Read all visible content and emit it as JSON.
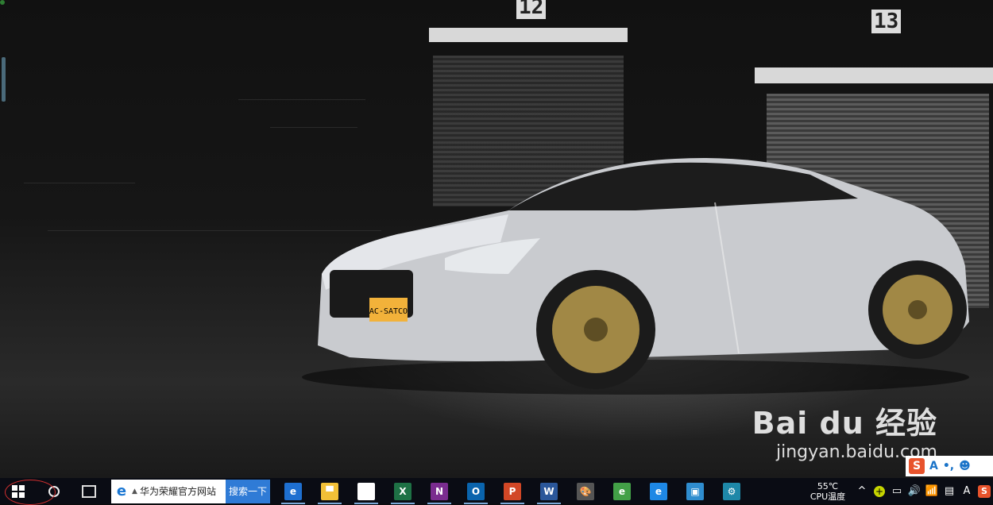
{
  "desktop": {
    "wallpaper": "silver sports car in dark garage",
    "bay_numbers": [
      "12",
      "13"
    ],
    "license_plate": "AC-SATCO",
    "watermark": {
      "logo": "Bai du 经验",
      "site": "jingyan.baidu.com"
    },
    "ime_bar": {
      "a_label": "A",
      "dot_label": "•,",
      "face_label": "☻",
      "s_label": "S"
    }
  },
  "taskbar": {
    "search": {
      "value": "华为荣耀官方网站",
      "button_label": "搜索一下",
      "ie_glyph": "e",
      "caret": "▲"
    },
    "pinned": [
      {
        "name": "edge",
        "glyph": "e",
        "color": "#1e6fd0"
      },
      {
        "name": "file-explorer",
        "glyph": "▀",
        "color": "#f2c037"
      },
      {
        "name": "store",
        "glyph": "⊞",
        "color": "#ffffff"
      },
      {
        "name": "excel",
        "glyph": "X",
        "color": "#1e7145"
      },
      {
        "name": "onenote",
        "glyph": "N",
        "color": "#7a2c8f"
      },
      {
        "name": "outlook",
        "glyph": "O",
        "color": "#0a64ad"
      },
      {
        "name": "powerpoint",
        "glyph": "P",
        "color": "#d24726"
      },
      {
        "name": "word",
        "glyph": "W",
        "color": "#2b579a"
      },
      {
        "name": "paint",
        "glyph": "🎨",
        "color": "#555555"
      },
      {
        "name": "360-browser",
        "glyph": "e",
        "color": "#43a047"
      },
      {
        "name": "internet-explorer",
        "glyph": "e",
        "color": "#1e88e5"
      },
      {
        "name": "photos",
        "glyph": "▣",
        "color": "#2f8dcf"
      },
      {
        "name": "settings",
        "glyph": "⚙",
        "color": "#1e88a8"
      }
    ],
    "tray": {
      "temperature": "55℃",
      "temperature_label": "CPU温度",
      "icons": [
        "^",
        "+",
        "▭",
        "🔊",
        "📶",
        "▤",
        "A",
        "S"
      ]
    }
  },
  "colors": {
    "taskbar_bg": "#0a0c14",
    "search_button": "#2f7bd6",
    "start_highlight": "#d32f2f"
  }
}
